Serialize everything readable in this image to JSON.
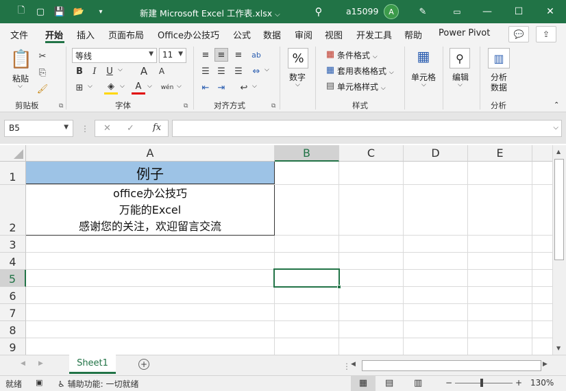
{
  "window": {
    "title": "新建 Microsoft Excel 工作表.xlsx",
    "user": "a15099",
    "avatar_initial": "A"
  },
  "menu": {
    "tabs": [
      "文件",
      "开始",
      "插入",
      "页面布局",
      "Office办公技巧",
      "公式",
      "数据",
      "审阅",
      "视图",
      "开发工具",
      "帮助",
      "Power Pivot"
    ],
    "active_index": 1
  },
  "ribbon": {
    "clipboard": {
      "paste": "粘贴",
      "group": "剪贴板"
    },
    "font": {
      "name": "等线",
      "size": "11",
      "group": "字体",
      "bold": "B",
      "italic": "I",
      "underline": "U",
      "grow": "A",
      "shrink": "A",
      "phonetic": "wén",
      "font_color": "A"
    },
    "alignment": {
      "group": "对齐方式"
    },
    "number": {
      "label": "数字",
      "symbol": "%"
    },
    "styles": {
      "conditional": "条件格式",
      "table": "套用表格格式",
      "cell_styles": "单元格样式",
      "group": "样式"
    },
    "cells": {
      "label": "单元格"
    },
    "edit": {
      "label": "编辑"
    },
    "analysis": {
      "label_line1": "分析",
      "label_line2": "数据",
      "group": "分析"
    }
  },
  "formula_bar": {
    "name_box": "B5",
    "fx": "fx",
    "value": ""
  },
  "grid": {
    "columns": [
      "A",
      "B",
      "C",
      "D",
      "E"
    ],
    "rows": [
      "1",
      "2",
      "3",
      "4",
      "5",
      "6",
      "7",
      "8",
      "9"
    ],
    "selected_cell": "B5",
    "a1": "例子",
    "a2_lines": [
      "office办公技巧",
      "万能的Excel",
      "感谢您的关注，欢迎留言交流"
    ]
  },
  "sheets": {
    "tabs": [
      "Sheet1"
    ],
    "add": "+"
  },
  "status": {
    "mode": "就绪",
    "accessibility": "辅助功能: 一切就绪",
    "zoom": "130%",
    "zoom_minus": "−",
    "zoom_plus": "+"
  },
  "colors": {
    "brand": "#217346",
    "header_fill": "#9dc3e6"
  }
}
